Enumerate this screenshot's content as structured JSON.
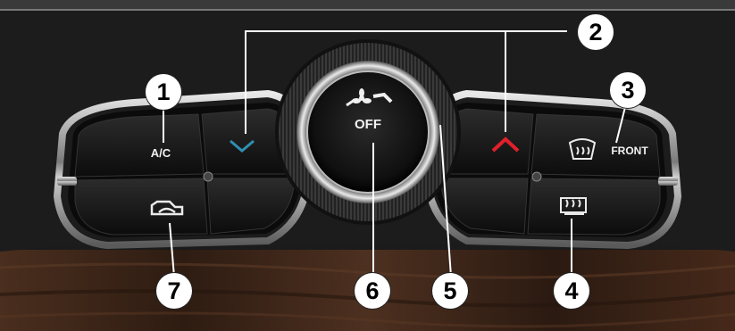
{
  "image": {
    "subject": "car climate control panel",
    "colors": {
      "panel": "#121212",
      "trim": "#bdbdbd",
      "wood": "#3a2418",
      "cool_arrow": "#2f8fb0",
      "warm_arrow": "#e0202a",
      "callout_fill": "#ffffff",
      "callout_text": "#000000",
      "label_text": "#f2f2f2"
    }
  },
  "buttons": {
    "ac_label": "A/C",
    "fan_knob_label": "OFF",
    "front_defrost_label": "FRONT"
  },
  "callouts": [
    "1",
    "2",
    "3",
    "4",
    "5",
    "6",
    "7"
  ],
  "icons": {
    "temp_down": "chevron-down-icon",
    "temp_up": "chevron-up-icon",
    "fan": "fan-icon",
    "front_defrost": "front-defrost-icon",
    "rear_defrost": "rear-defrost-icon",
    "recirculation": "recirculation-icon"
  }
}
